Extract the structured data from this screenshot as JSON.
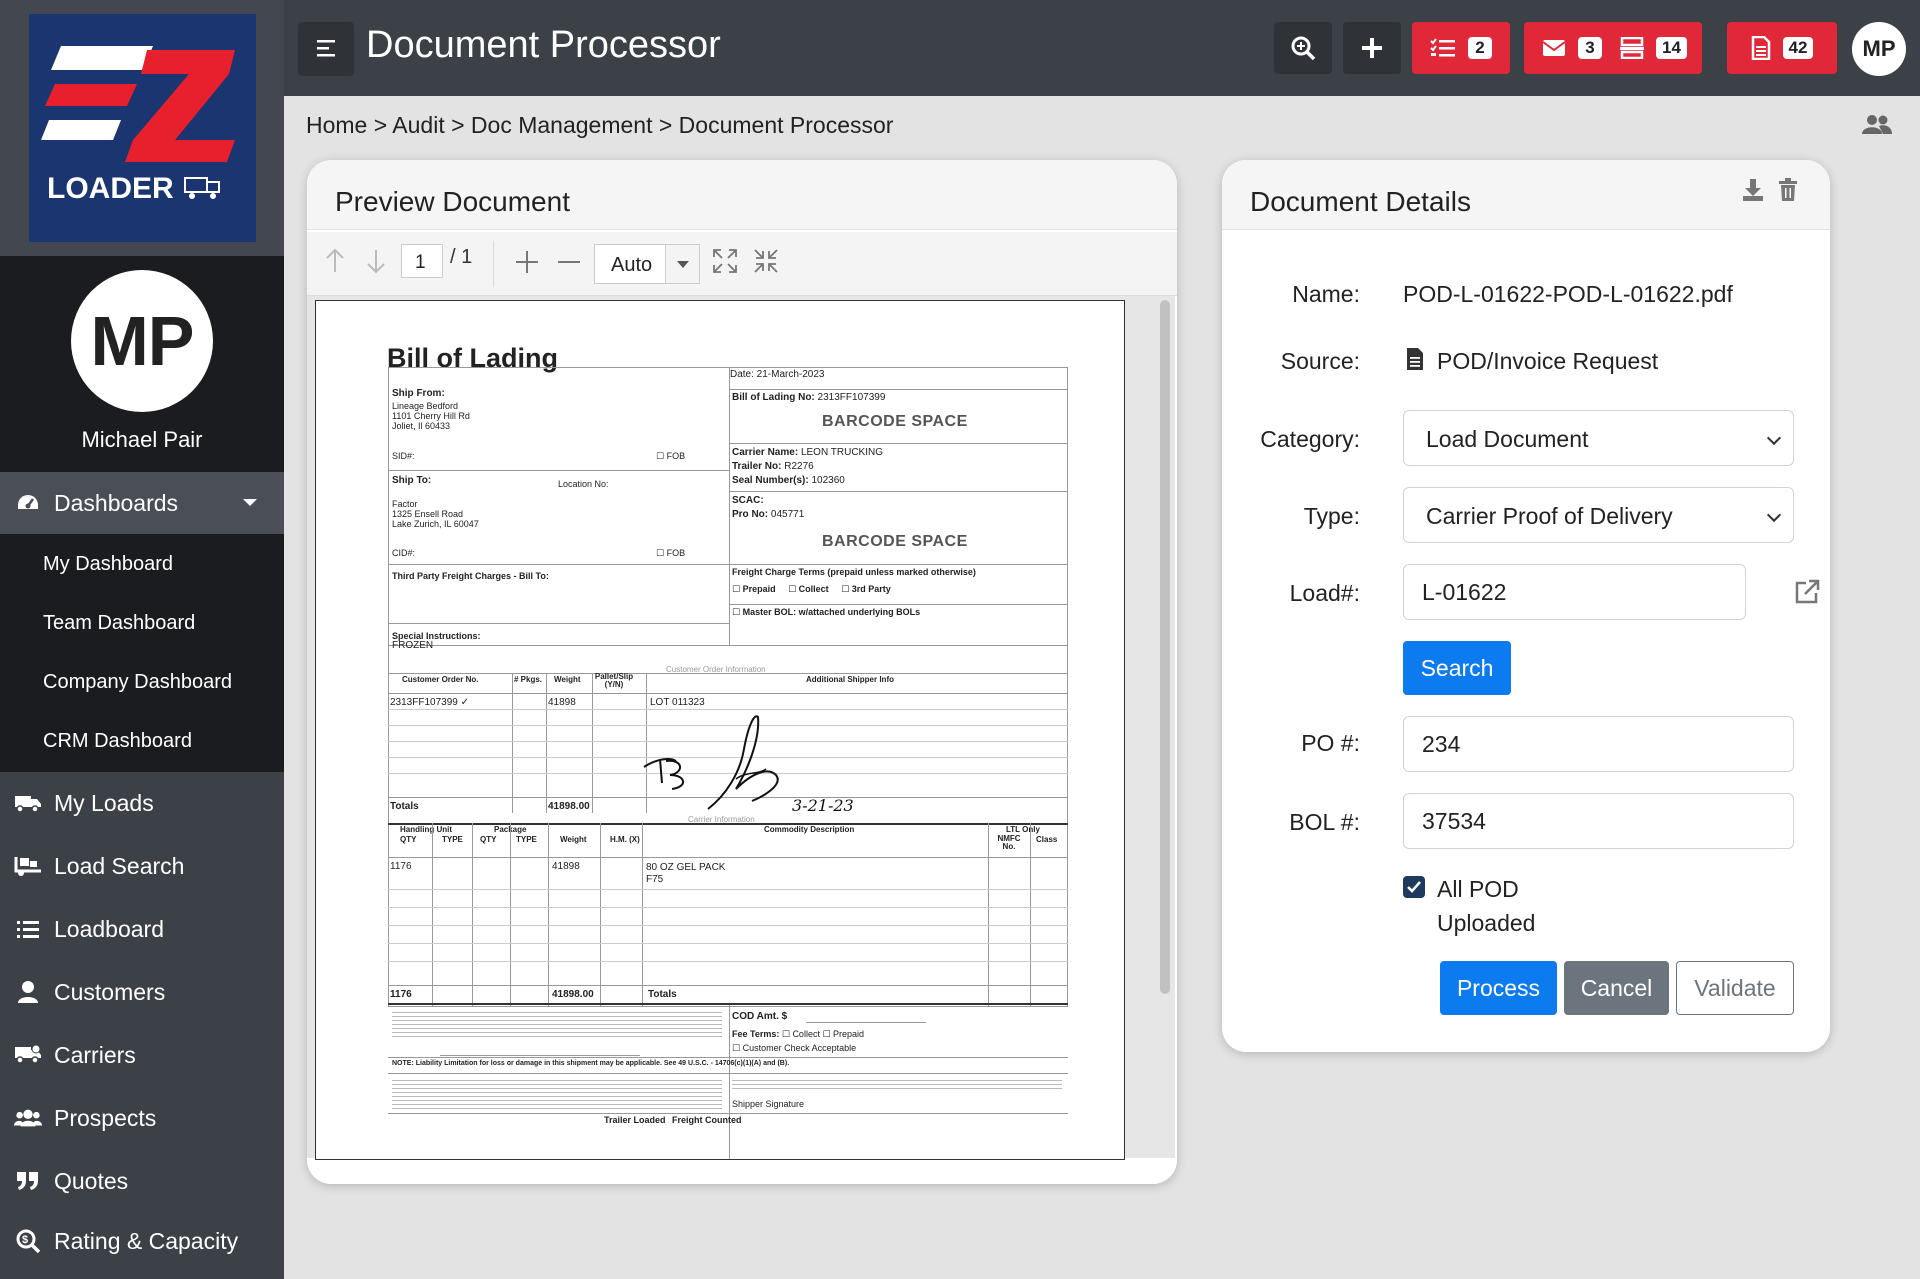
{
  "app": {
    "title": "Document Processor",
    "logo_text": "LOADER"
  },
  "user": {
    "initials": "MP",
    "name": "Michael Pair"
  },
  "sidebar": {
    "dashboards_label": "Dashboards",
    "dashboard_items": [
      "My Dashboard",
      "Team Dashboard",
      "Company Dashboard",
      "CRM Dashboard"
    ],
    "items": [
      {
        "label": "My Loads",
        "icon": "truck-icon"
      },
      {
        "label": "Load Search",
        "icon": "truck-loading-icon"
      },
      {
        "label": "Loadboard",
        "icon": "list-icon"
      },
      {
        "label": "Customers",
        "icon": "user-icon"
      },
      {
        "label": "Carriers",
        "icon": "truck-icon"
      },
      {
        "label": "Prospects",
        "icon": "users-icon"
      },
      {
        "label": "Quotes",
        "icon": "quote-icon"
      },
      {
        "label": "Rating & Capacity",
        "icon": "search-dollar-icon"
      }
    ]
  },
  "topbar": {
    "badges": {
      "tasks": "2",
      "mail": "3",
      "inbox": "14",
      "documents": "42"
    }
  },
  "breadcrumb": "Home > Audit > Doc Management > Document Processor",
  "preview": {
    "title": "Preview Document",
    "page_current": "1",
    "page_total": "/ 1",
    "zoom": "Auto"
  },
  "bol": {
    "title": "Bill of Lading",
    "date": "Date: 21-March-2023",
    "bol_no_label": "Bill of Lading No:",
    "bol_no": "2313FF107399",
    "barcode": "BARCODE SPACE",
    "ship_from_label": "Ship From:",
    "ship_from": [
      "Lineage Bedford",
      "1101 Cherry Hill Rd",
      "Joliet, Il 60433"
    ],
    "sid": "SID#:",
    "fob": "FOB",
    "carrier_name_label": "Carrier Name:",
    "carrier_name": "LEON TRUCKING",
    "trailer_label": "Trailer No:",
    "trailer": "R2276",
    "seal_label": "Seal Number(s):",
    "seal": "102360",
    "ship_to_label": "Ship To:",
    "location_label": "Location No:",
    "ship_to": [
      "Factor",
      "1325 Ensell Road",
      "Lake Zurich, IL 60047"
    ],
    "scac_label": "SCAC:",
    "pro_label": "Pro No:",
    "pro": "045771",
    "cid": "CID#:",
    "third_party": "Third Party Freight Charges - Bill To:",
    "freight_terms": "Freight Charge Terms (prepaid unless marked otherwise)",
    "prepaid": "Prepaid",
    "collect": "Collect",
    "third_party_opt": "3rd Party",
    "master_bol": "Master BOL: w/attached underlying BOLs",
    "special_label": "Special Instructions:",
    "special": "FROZEN",
    "coi": "Customer Order Information",
    "coi_headers": [
      "Customer Order No.",
      "# Pkgs.",
      "Weight",
      "Pallet/Slip (Y/N)",
      "Additional Shipper Info"
    ],
    "coi_row": [
      "2313FF107399",
      "41898",
      "LOT 011323"
    ],
    "totals": "Totals",
    "totals_weight": "41898.00",
    "carrier_info": "Carrier Information",
    "ci_headers": [
      "Handling Unit",
      "Package",
      "QTY",
      "TYPE",
      "QTY",
      "TYPE",
      "Weight",
      "H.M. (X)",
      "Commodity Description",
      "LTL Only",
      "NMFC No.",
      "Class"
    ],
    "ci_row": [
      "1176",
      "41898",
      "80 OZ GEL PACK",
      "F75"
    ],
    "ci_total_qty": "1176",
    "ci_total_weight": "41898.00",
    "ci_totals": "Totals",
    "cod": "COD Amt. $",
    "fee_terms": "Fee Terms:",
    "customer_check": "Customer Check Acceptable",
    "liability": "NOTE: Liability Limitation for loss or damage in this shipment may be applicable. See 49 U.S.C. - 14706(c)(1)(A) and (B).",
    "shipper_signature": "Shipper Signature",
    "trailer_loaded": "Trailer Loaded",
    "freight_counted": "Freight Counted",
    "signature_date": "3-21-23"
  },
  "details": {
    "title": "Document Details",
    "name_label": "Name:",
    "name": "POD-L-01622-POD-L-01622.pdf",
    "source_label": "Source:",
    "source": "POD/Invoice Request",
    "category_label": "Category:",
    "category": "Load Document",
    "type_label": "Type:",
    "type": "Carrier Proof of Delivery",
    "load_label": "Load#:",
    "load": "L-01622",
    "search_btn": "Search",
    "po_label": "PO #:",
    "po": "234",
    "bol_label": "BOL #:",
    "bol": "37534",
    "all_pod_1": "All POD",
    "all_pod_2": "Uploaded",
    "all_pod_checked": true,
    "process_btn": "Process",
    "cancel_btn": "Cancel",
    "validate_btn": "Validate"
  },
  "colors": {
    "primary": "#0d7bf0",
    "danger": "#e02839",
    "secondary": "#6c757d",
    "dark": "#3c4047",
    "logo_bg": "#1a3570",
    "logo_red": "#e8202e"
  }
}
